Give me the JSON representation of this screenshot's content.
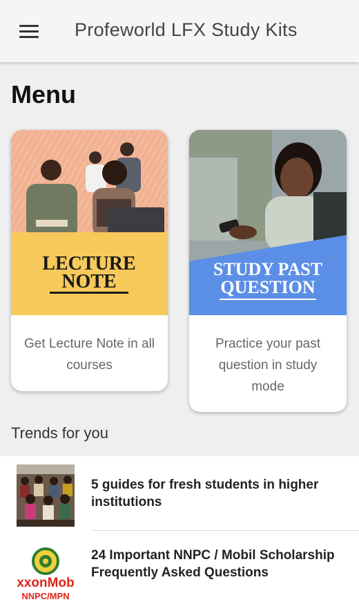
{
  "appbar": {
    "title": "Profeworld LFX Study Kits",
    "menu_icon": "hamburger-icon"
  },
  "page": {
    "title": "Menu"
  },
  "cards": [
    {
      "image_text_line1": "LECTURE",
      "image_text_line2": "NOTE",
      "description": "Get Lecture Note in all courses",
      "accent": "#f6c95a"
    },
    {
      "image_text_line1": "STUDY PAST",
      "image_text_line2": "QUESTION",
      "description": "Practice your past question in study mode",
      "accent": "#5b8fe6"
    }
  ],
  "trends": {
    "label": "Trends for you",
    "items": [
      {
        "title": "5 guides for fresh students in higher institutions"
      },
      {
        "title": "24 Important NNPC / Mobil Scholarship Frequently Asked Questions",
        "logo_text_1": "xxonMob",
        "logo_text_2": "NNPC/MPN"
      }
    ]
  }
}
